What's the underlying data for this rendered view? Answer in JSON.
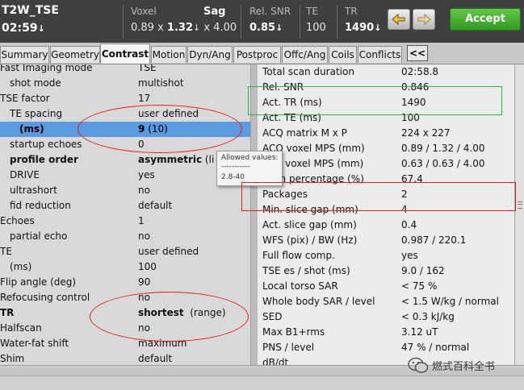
{
  "header": {
    "protocol": "T2W_TSE",
    "scan_time": "02:59",
    "voxel_label": "Voxel",
    "voxel_value_a": "0.89 x",
    "voxel_value_b": "1.32",
    "voxel_value_c": "x 4.00",
    "orientation": "Sag",
    "rel_snr_label": "Rel. SNR",
    "rel_snr_value": "0.85",
    "te_label": "TE",
    "te_value": "100",
    "tr_label": "TR",
    "tr_value": "1490",
    "down_arrow": "↓",
    "accept_label": "Accept"
  },
  "tabs": [
    {
      "label": "Summary"
    },
    {
      "label": "Geometry"
    },
    {
      "label": "Contrast"
    },
    {
      "label": "Motion"
    },
    {
      "label": "Dyn/Ang"
    },
    {
      "label": "Postproc"
    },
    {
      "label": "Offc/Ang"
    },
    {
      "label": "Coils"
    },
    {
      "label": "Conflicts"
    }
  ],
  "tabs_more": "<<",
  "params": [
    {
      "label": "Fast Imaging mode",
      "value": "TSE"
    },
    {
      "label": "shot mode",
      "value": "multishot"
    },
    {
      "label": "TSE factor",
      "value": "17"
    },
    {
      "label": "TE spacing",
      "value": "user defined"
    },
    {
      "label": "(ms)",
      "value": "9",
      "extra": "(10)"
    },
    {
      "label": "startup echoes",
      "value": "0"
    },
    {
      "label": "profile order",
      "value": "asymmetric",
      "extra": "(li"
    },
    {
      "label": "DRIVE",
      "value": "yes"
    },
    {
      "label": "ultrashort",
      "value": "no"
    },
    {
      "label": "fid reduction",
      "value": "default"
    },
    {
      "label": "Echoes",
      "value": "1"
    },
    {
      "label": "partial echo",
      "value": "no"
    },
    {
      "label": "TE",
      "value": "user defined"
    },
    {
      "label": "(ms)",
      "value": "100"
    },
    {
      "label": "Flip angle (deg)",
      "value": "90"
    },
    {
      "label": "Refocusing control",
      "value": "no"
    },
    {
      "label": "TR",
      "value": "shortest",
      "extra": "(range)"
    },
    {
      "label": "Halfscan",
      "value": "no"
    },
    {
      "label": "Water-fat shift",
      "value": "maximum"
    },
    {
      "label": "Shim",
      "value": "default"
    }
  ],
  "info": [
    {
      "label": "Total scan duration",
      "value": "02:58.8"
    },
    {
      "label": "Rel. SNR",
      "value": "0.846"
    },
    {
      "label": "Act. TR (ms)",
      "value": "1490"
    },
    {
      "label": "Act. TE (ms)",
      "value": "100"
    },
    {
      "label": "ACQ matrix M x P",
      "value": "224 x 227"
    },
    {
      "label": "ACQ voxel MPS (mm)",
      "value": "0.89 / 1.32 / 4.00"
    },
    {
      "label": "REC voxel MPS (mm)",
      "value": "0.63 / 0.63 / 4.00"
    },
    {
      "label": "Scan percentage (%)",
      "value": "67.4"
    },
    {
      "label": "Packages",
      "value": "2"
    },
    {
      "label": "Min. slice gap (mm)",
      "value": "4"
    },
    {
      "label": "Act. slice gap (mm)",
      "value": "0.4"
    },
    {
      "label": "WFS (pix) / BW (Hz)",
      "value": "0.987 / 220.1"
    },
    {
      "label": "Full flow comp.",
      "value": "yes"
    },
    {
      "label": "TSE es / shot (ms)",
      "value": "9.0 / 162"
    },
    {
      "label": "Local torso SAR",
      "value": "< 75 %"
    },
    {
      "label": "Whole body SAR / level",
      "value": "< 1.5 W/kg / normal"
    },
    {
      "label": "SED",
      "value": "< 0.3 kJ/kg"
    },
    {
      "label": "Max B1+rms",
      "value": "3.12 uT"
    },
    {
      "label": "PNS / level",
      "value": "47 % / normal"
    },
    {
      "label": "dB/dt",
      "value": ""
    }
  ],
  "tooltip": {
    "title": "Allowed values:",
    "divider": "-----------",
    "range": "2.8-40"
  },
  "watermark": "燃式百科全书",
  "colors": {
    "header_bg": "#3f3f3f",
    "accept": "#3ca82a",
    "selection": "#5b9ae0",
    "annotation_red": "#e0211e",
    "annotation_green": "#2db34a"
  }
}
